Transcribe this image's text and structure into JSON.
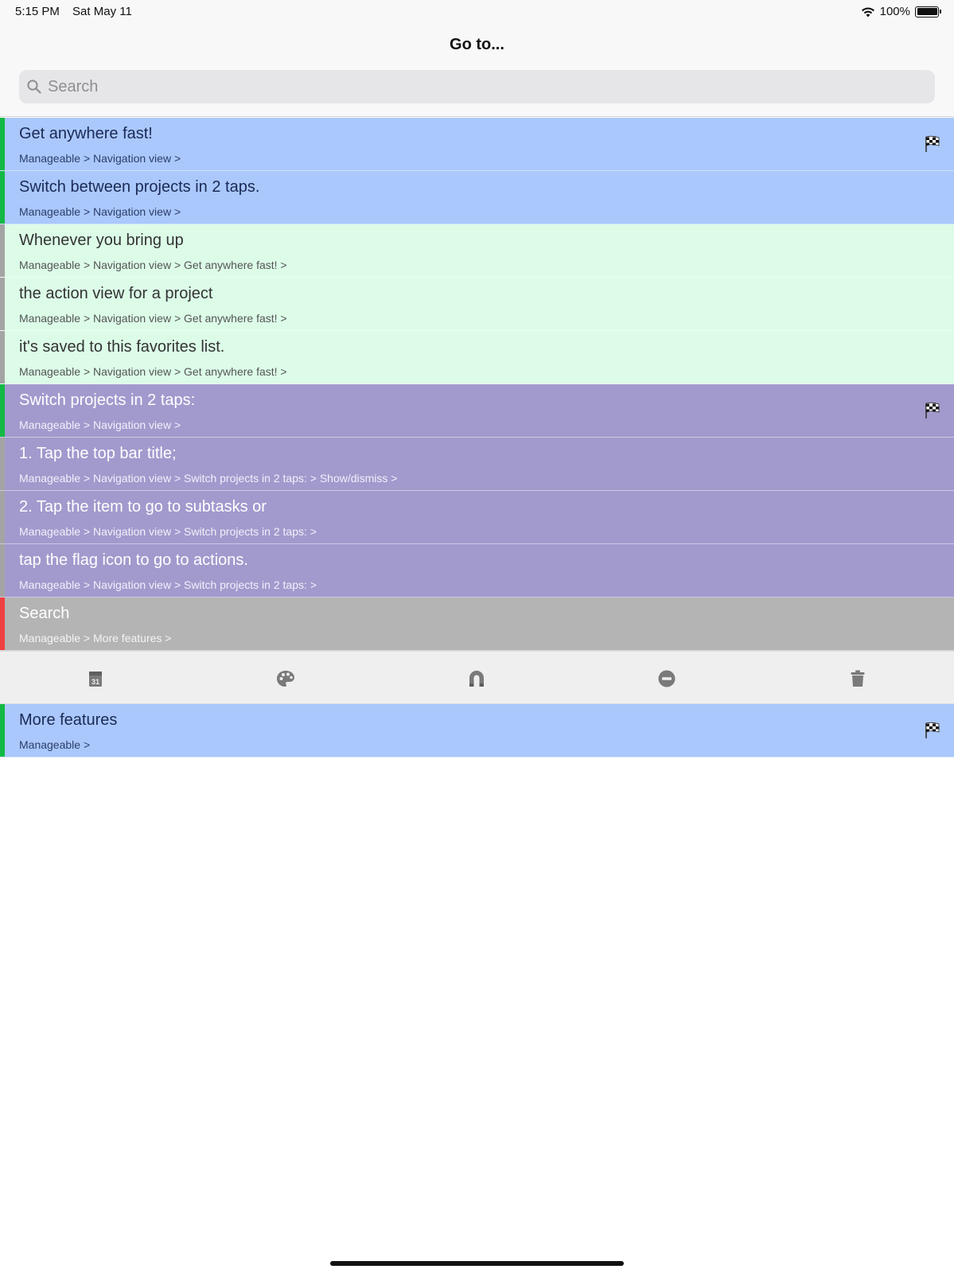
{
  "status": {
    "time": "5:15 PM",
    "date": "Sat May 11",
    "battery": "100%"
  },
  "header": {
    "title": "Go to..."
  },
  "search": {
    "placeholder": "Search"
  },
  "colors": {
    "blue": "#aac8fc",
    "mint": "#dcfce8",
    "purple": "#a29acd",
    "gray": "#b4b4b4",
    "green_bar": "#12b944",
    "gray_bar": "#a4a4a4",
    "red_bar": "#f04040"
  },
  "rows": [
    {
      "title": "Get anywhere fast!",
      "path": "Manageable > Navigation view >",
      "flag": true
    },
    {
      "title": "Switch between projects in 2 taps.",
      "path": "Manageable > Navigation view >",
      "flag": false
    },
    {
      "title": "Whenever you bring up",
      "path": "Manageable > Navigation view > Get anywhere fast! >",
      "flag": false
    },
    {
      "title": "the action view for a project",
      "path": "Manageable > Navigation view > Get anywhere fast! >",
      "flag": false
    },
    {
      "title": "it's saved to this favorites list.",
      "path": "Manageable > Navigation view > Get anywhere fast! >",
      "flag": false
    },
    {
      "title": "Switch projects in 2 taps:",
      "path": "Manageable > Navigation view >",
      "flag": true
    },
    {
      "title": "1. Tap the top bar title;",
      "path": "Manageable > Navigation view > Switch projects in 2 taps: > Show/dismiss >",
      "flag": false
    },
    {
      "title": "2. Tap the item to go to subtasks or",
      "path": "Manageable > Navigation view > Switch projects in 2 taps: >",
      "flag": false
    },
    {
      "title": "tap the flag icon to go to actions.",
      "path": "Manageable > Navigation view > Switch projects in 2 taps: >",
      "flag": false
    },
    {
      "title": "Search",
      "path": "Manageable > More features >",
      "flag": false
    },
    {
      "title": "More features",
      "path": "Manageable >",
      "flag": true
    }
  ],
  "toolbar": {
    "icons": [
      "calendar-icon",
      "palette-icon",
      "magnet-icon",
      "minus-circle-icon",
      "trash-icon"
    ]
  }
}
